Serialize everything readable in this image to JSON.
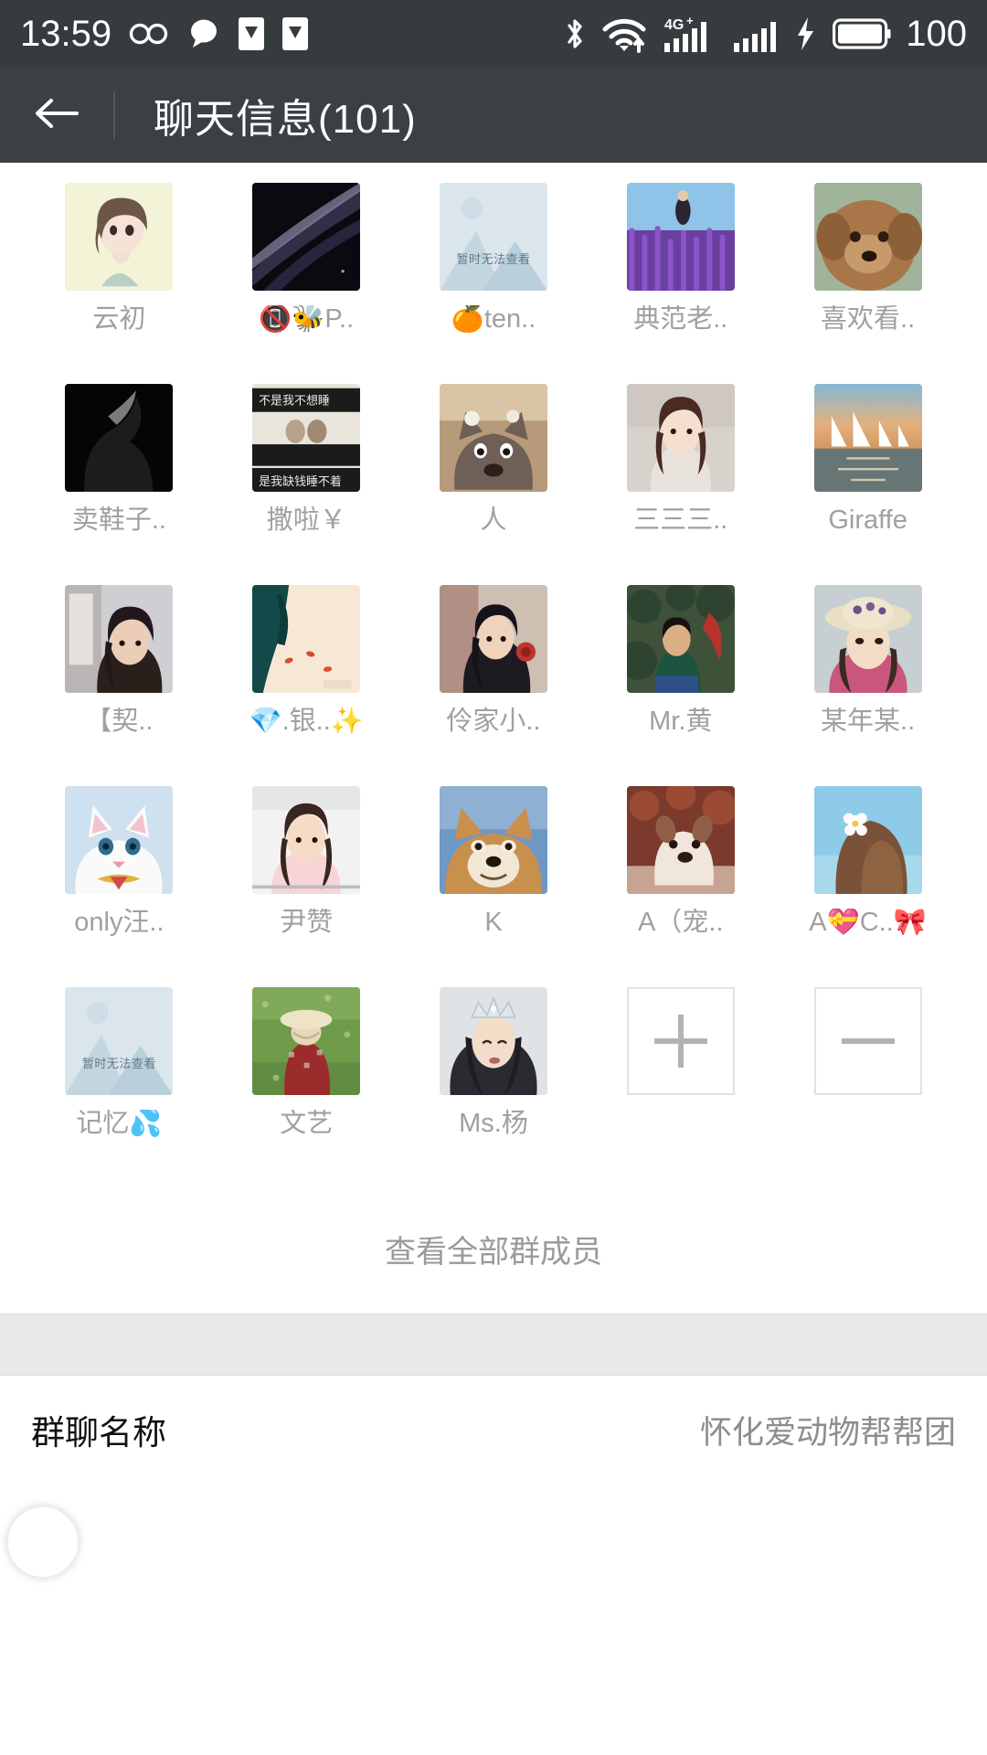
{
  "statusbar": {
    "time": "13:59",
    "battery_percent": "100",
    "icons": [
      "infinity-icon",
      "chat-bubble-icon",
      "download-icon",
      "download-icon-2",
      "bluetooth-icon",
      "wifi-icon",
      "signal-4g-icon",
      "signal-icon",
      "charging-bolt-icon",
      "battery-icon"
    ],
    "network_label": "4G+"
  },
  "appbar": {
    "back_icon": "back-arrow-icon",
    "title": "聊天信息(101)"
  },
  "members": [
    {
      "name": "云初",
      "avatar": "girl-illustration",
      "placeholder": false
    },
    {
      "name": "📵🐝P..",
      "avatar": "dark-silk",
      "placeholder": false
    },
    {
      "name": "🍊ten..",
      "avatar": "unavailable",
      "placeholder": true,
      "placeholder_text": "暂时无法查看"
    },
    {
      "name": "典范老..",
      "avatar": "lavender-field",
      "placeholder": false
    },
    {
      "name": "喜欢看..",
      "avatar": "poodle-dog",
      "placeholder": false
    },
    {
      "name": "卖鞋子..",
      "avatar": "black-silhouette",
      "placeholder": false
    },
    {
      "name": "撒啦￥",
      "avatar": "text-meme",
      "placeholder": false
    },
    {
      "name": "人",
      "avatar": "cat-meme",
      "placeholder": false
    },
    {
      "name": "三三三..",
      "avatar": "selfie-woman",
      "placeholder": false
    },
    {
      "name": "Giraffe",
      "avatar": "sailboats-sunset",
      "placeholder": false
    },
    {
      "name": "【契..",
      "avatar": "portrait-indoor",
      "placeholder": false
    },
    {
      "name": "💎.银..✨",
      "avatar": "legs-petals",
      "placeholder": false
    },
    {
      "name": "伶家小..",
      "avatar": "girl-rose",
      "placeholder": false
    },
    {
      "name": "Mr.黄",
      "avatar": "boy-outdoors",
      "placeholder": false
    },
    {
      "name": "某年某..",
      "avatar": "girl-hat",
      "placeholder": false
    },
    {
      "name": "only汪..",
      "avatar": "white-cat",
      "placeholder": false
    },
    {
      "name": "尹赞",
      "avatar": "woman-portrait",
      "placeholder": false
    },
    {
      "name": "K",
      "avatar": "shiba-dog",
      "placeholder": false
    },
    {
      "name": "A（宠..",
      "avatar": "bulldog",
      "placeholder": false
    },
    {
      "name": "A💝C..🎀",
      "avatar": "girl-flower-hair",
      "placeholder": false
    },
    {
      "name": "记忆💦",
      "avatar": "unavailable",
      "placeholder": true,
      "placeholder_text": "暂时无法查看"
    },
    {
      "name": "文艺",
      "avatar": "child-grass",
      "placeholder": false
    },
    {
      "name": "Ms.杨",
      "avatar": "woman-crown",
      "placeholder": false
    }
  ],
  "actions": {
    "add_label": "add-member-button",
    "remove_label": "remove-member-button"
  },
  "view_all": {
    "label": "查看全部群成员"
  },
  "group_name_row": {
    "label": "群聊名称",
    "value": "怀化爱动物帮帮团"
  },
  "colors": {
    "statusbar_bg": "#363b3e",
    "appbar_bg": "#3b4045",
    "page_bg": "#ffffff",
    "muted_text": "#a0a0a0",
    "band_bg": "#e8e8e8"
  }
}
